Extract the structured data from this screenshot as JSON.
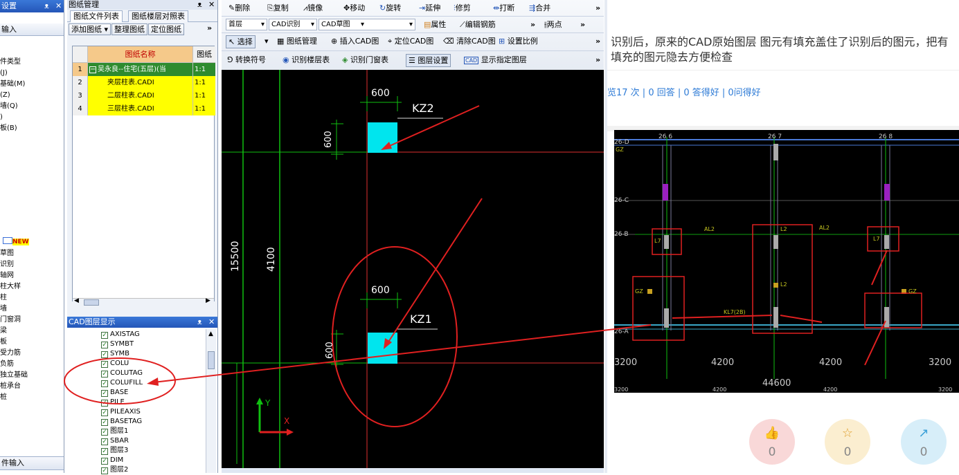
{
  "left_panel": {
    "header": "设置",
    "btn": "输入",
    "items": [
      "件类型",
      "(J)",
      "基础(M)",
      "(Z)",
      "墙(Q)",
      ")",
      "板(B)"
    ],
    "new_badge": "NEW",
    "items2": [
      "草图",
      "识别",
      "轴网",
      "柱大样",
      "柱",
      "墙",
      "门窗洞",
      "梁",
      "板",
      "受力筋",
      "负筋",
      "独立基础",
      "桩承台",
      "桩"
    ],
    "footer": "件输入"
  },
  "drawing_panel": {
    "title": "图纸管理",
    "tabs": [
      "图纸文件列表",
      "图纸楼层对照表"
    ],
    "buttons": [
      "添加图纸",
      "整理图纸",
      "定位图纸"
    ],
    "more": "»",
    "columns": [
      "图纸名称",
      "图纸比"
    ],
    "rows": [
      {
        "n": "1",
        "name": "吴永良--住宅(五层)(当",
        "scale": "1:1"
      },
      {
        "n": "2",
        "name": "夹层柱表.CADI",
        "scale": "1:1"
      },
      {
        "n": "3",
        "name": "二层柱表.CADI",
        "scale": "1:1"
      },
      {
        "n": "4",
        "name": "三层柱表.CADI",
        "scale": "1:1"
      }
    ]
  },
  "layer_panel": {
    "title": "CAD图层显示",
    "layers": [
      "AXISTAG",
      "SYMBT",
      "SYMB",
      "COLU",
      "COLUTAG",
      "COLUFILL",
      "BASE",
      "PILE",
      "PILEAXIS",
      "BASETAG",
      "图层1",
      "SBAR",
      "图层3",
      "DIM",
      "图层2"
    ]
  },
  "toolbar1": [
    "删除",
    "复制",
    "镜像",
    "移动",
    "旋转",
    "延伸",
    "修剪",
    "打断",
    "合并"
  ],
  "toolbar2": {
    "floor": "首层",
    "mode": "CAD识别",
    "sketch": "CAD草图",
    "props": "属性",
    "edit": "编辑钢筋",
    "two_point": "两点"
  },
  "toolbar3": {
    "select": "选择",
    "items": [
      "图纸管理",
      "插入CAD图",
      "定位CAD图",
      "清除CAD图",
      "设置比例"
    ]
  },
  "toolbar4": [
    "转换符号",
    "识别楼层表",
    "识别门窗表",
    "图层设置",
    "显示指定图层"
  ],
  "cad": {
    "dim1": "600",
    "label1": "KZ2",
    "dim2": "600",
    "dim3": "600",
    "label2": "KZ1",
    "dim4": "600",
    "v1": "15500",
    "v2": "4100",
    "y": "Y",
    "x": "X"
  },
  "right": {
    "question": "识别后，原来的CAD原始图层 图元有填充盖住了识别后的图元，把有填充的图元隐去方便检查",
    "stats": "览17 次 | 0 回答 | 0 答得好 | 0问得好",
    "img_labels": {
      "top": [
        "26 6",
        "26 7",
        "26 8"
      ],
      "rows": [
        "26-D",
        "26-C",
        "26-B",
        "26-A"
      ],
      "dims": [
        "3200",
        "4200",
        "4200",
        "3200"
      ],
      "total": "44600",
      "small": [
        "3200",
        "4200",
        "4200",
        "3200"
      ],
      "gz": "GZ",
      "l7": "L7",
      "l2": "L2",
      "al2": "AL2",
      "kl7": "KL7(2B)",
      "l2b": "L2"
    },
    "buttons": [
      {
        "icon": "👍",
        "count": "0"
      },
      {
        "icon": "☆",
        "count": "0"
      },
      {
        "icon": "↗",
        "count": "0"
      }
    ]
  },
  "colors": {
    "cyan": "#00e5ee",
    "red_annot": "#e02020",
    "like": "#f9d8d8",
    "fav": "#fbeed0",
    "share": "#d7eef9"
  }
}
